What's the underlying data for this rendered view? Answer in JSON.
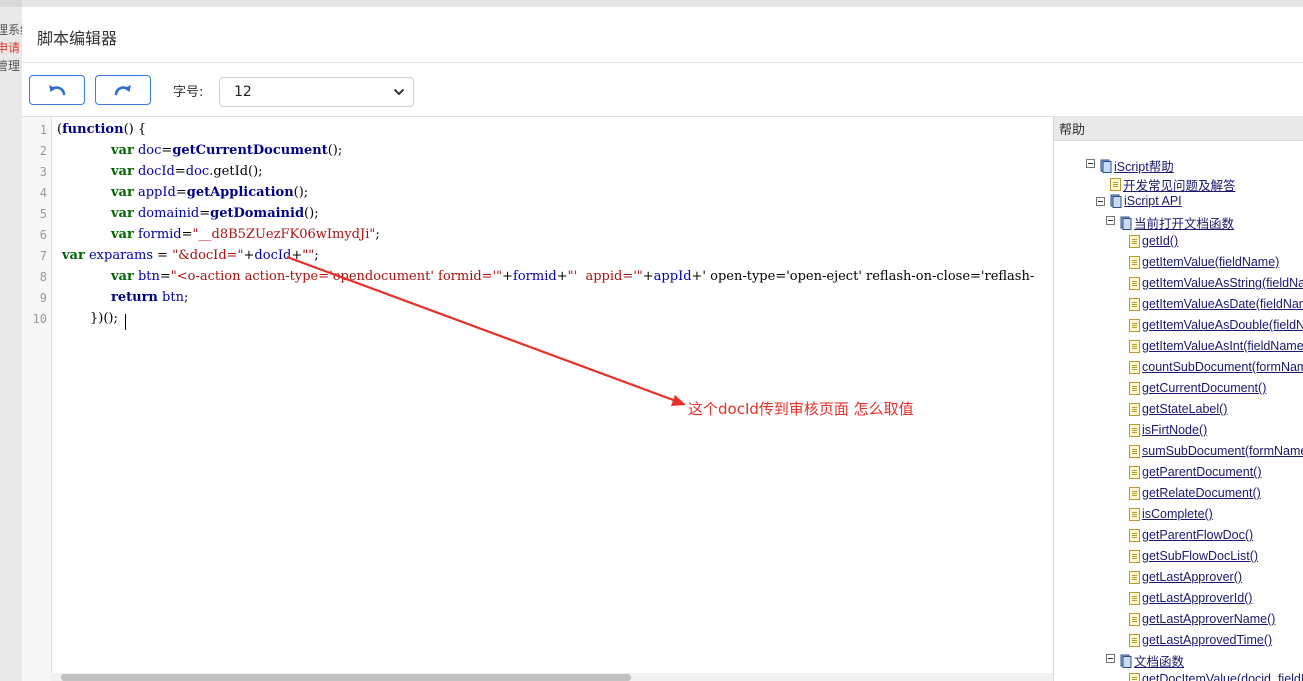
{
  "background": {
    "fragments": [
      "理系统",
      "申请",
      "管理"
    ]
  },
  "dialog": {
    "title": "脚本编辑器"
  },
  "toolbar": {
    "undo_icon": "undo-icon",
    "redo_icon": "redo-icon",
    "font_size_label": "字号:",
    "font_size_value": "12",
    "accent_color": "#3a7bd5"
  },
  "editor": {
    "line_numbers": [
      "1",
      "2",
      "3",
      "4",
      "5",
      "6",
      "7",
      "8",
      "9",
      "10"
    ],
    "lines": [
      "(function() {",
      "var doc=getCurrentDocument();",
      "var docId=doc.getId();",
      "var appId=getApplication();",
      "var domainid=getDomainid();",
      "var formid=\"__d8B5ZUezFK06wImydJi\";",
      "var exparams = \"&docId=\"+docId+\"\";",
      "var btn=\"<o-action action-type='opendocument' formid='\"+formid+\"'  appid='\"+appId+\"' open-type='open-eject' reflash-on-close='reflash-",
      "return btn;",
      "})();"
    ]
  },
  "help": {
    "title": "帮助",
    "tree": [
      {
        "label": "iScript帮助",
        "icon": "book-icon"
      },
      {
        "label": "开发常见问题及解答",
        "icon": "document-icon"
      },
      {
        "label": "iScript API",
        "icon": "book-icon"
      },
      {
        "label": "当前打开文档函数",
        "icon": "book-icon"
      },
      {
        "label": "getId()",
        "icon": "document-icon"
      },
      {
        "label": "getItemValue(fieldName)",
        "icon": "document-icon"
      },
      {
        "label": "getItemValueAsString(fieldNam",
        "icon": "document-icon"
      },
      {
        "label": "getItemValueAsDate(fieldNam",
        "icon": "document-icon"
      },
      {
        "label": "getItemValueAsDouble(fieldNa",
        "icon": "document-icon"
      },
      {
        "label": "getItemValueAsInt(fieldName)",
        "icon": "document-icon"
      },
      {
        "label": "countSubDocument(formNam",
        "icon": "document-icon"
      },
      {
        "label": "getCurrentDocument()",
        "icon": "document-icon"
      },
      {
        "label": "getStateLabel()",
        "icon": "document-icon"
      },
      {
        "label": "isFirtNode()",
        "icon": "document-icon"
      },
      {
        "label": "sumSubDocument(formName,",
        "icon": "document-icon"
      },
      {
        "label": "getParentDocument()",
        "icon": "document-icon"
      },
      {
        "label": "getRelateDocument()",
        "icon": "document-icon"
      },
      {
        "label": "isComplete()",
        "icon": "document-icon"
      },
      {
        "label": "getParentFlowDoc()",
        "icon": "document-icon"
      },
      {
        "label": "getSubFlowDocList()",
        "icon": "document-icon"
      },
      {
        "label": "getLastApprover()",
        "icon": "document-icon"
      },
      {
        "label": "getLastApproverId()",
        "icon": "document-icon"
      },
      {
        "label": "getLastApproverName()",
        "icon": "document-icon"
      },
      {
        "label": "getLastApprovedTime()",
        "icon": "document-icon"
      },
      {
        "label": "文档函数",
        "icon": "book-icon"
      },
      {
        "label": "getDocItemValue(docid, fieldN",
        "icon": "document-icon"
      }
    ]
  },
  "annotation": {
    "text": "这个docId传到审核页面 怎么取值",
    "color": "#e8302a"
  }
}
